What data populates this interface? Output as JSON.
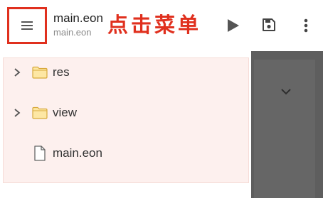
{
  "header": {
    "title": "main.eon",
    "subtitle": "main.eon",
    "annotation": "点击菜单",
    "icons": {
      "menu": "hamburger-menu-icon",
      "run": "play-icon",
      "save": "save-icon",
      "more": "more-vert-icon"
    },
    "highlight_color": "#e0301e"
  },
  "file_tree": {
    "items": [
      {
        "label": "res",
        "type": "folder",
        "expandable": true
      },
      {
        "label": "view",
        "type": "folder",
        "expandable": true
      },
      {
        "label": "main.eon",
        "type": "file",
        "expandable": false
      }
    ]
  },
  "editor_pane": {
    "icon": "expand-more-icon",
    "overlay_color": "#5e5e5e"
  }
}
